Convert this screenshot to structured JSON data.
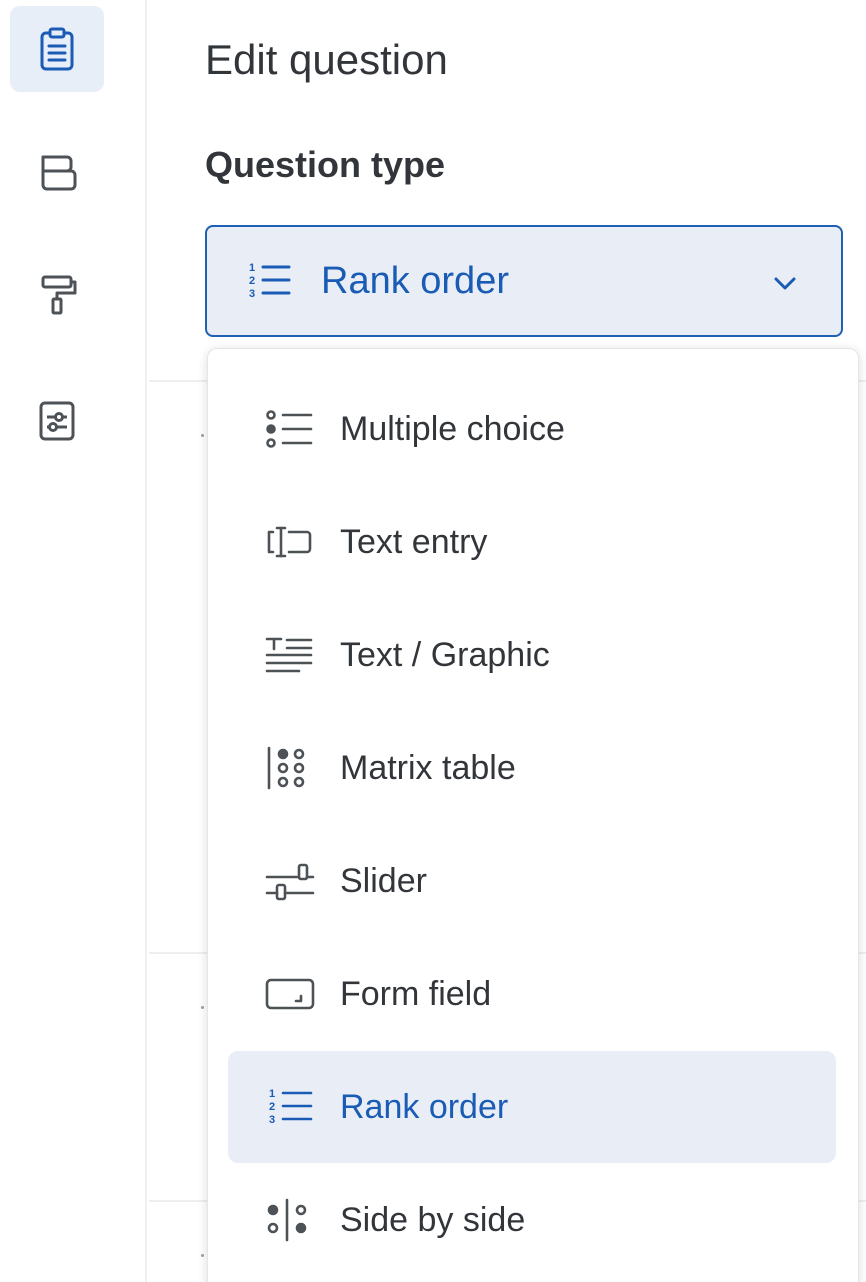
{
  "sidebar": {
    "items": [
      {
        "icon": "clipboard-icon",
        "active": true
      },
      {
        "icon": "layout-blocks-icon",
        "active": false
      },
      {
        "icon": "paint-roller-icon",
        "active": false
      },
      {
        "icon": "settings-sliders-icon",
        "active": false
      }
    ]
  },
  "panel": {
    "title": "Edit question",
    "section_label": "Question type"
  },
  "question_type_select": {
    "selected_label": "Rank order",
    "icon": "rank-order-icon"
  },
  "dropdown": {
    "options": [
      {
        "label": "Multiple choice",
        "icon": "multiple-choice-icon"
      },
      {
        "label": "Text entry",
        "icon": "text-entry-icon"
      },
      {
        "label": "Text / Graphic",
        "icon": "text-graphic-icon"
      },
      {
        "label": "Matrix table",
        "icon": "matrix-table-icon"
      },
      {
        "label": "Slider",
        "icon": "slider-icon"
      },
      {
        "label": "Form field",
        "icon": "form-field-icon"
      },
      {
        "label": "Rank order",
        "icon": "rank-order-icon",
        "selected": true
      },
      {
        "label": "Side by side",
        "icon": "side-by-side-icon"
      }
    ]
  },
  "colors": {
    "accent": "#1a5bb5",
    "selected_bg": "#e9eef6",
    "icon_gray": "#5f6368",
    "text": "#32363a"
  }
}
